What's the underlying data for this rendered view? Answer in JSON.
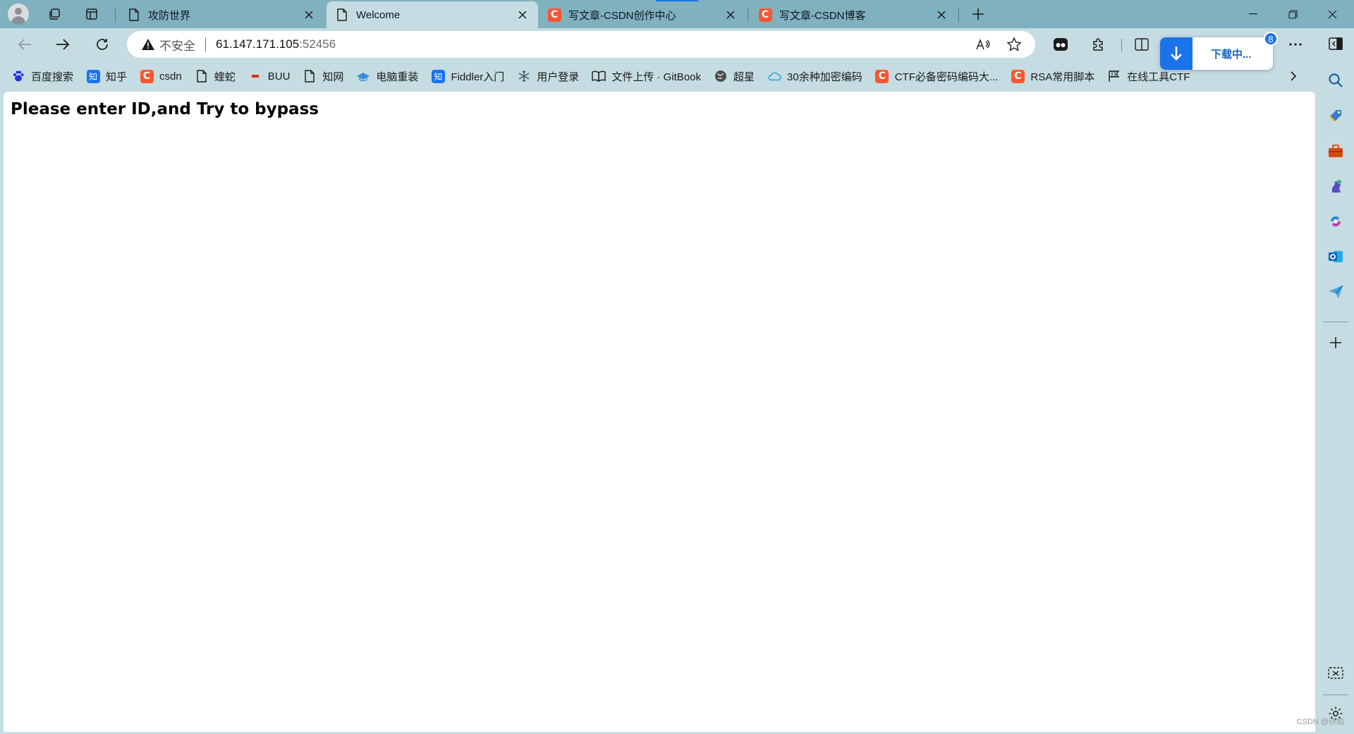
{
  "tabs": [
    {
      "title": "攻防世界",
      "icon": "page-icon",
      "active": false
    },
    {
      "title": "Welcome",
      "icon": "page-icon",
      "active": true
    },
    {
      "title": "写文章-CSDN创作中心",
      "icon": "csdn-icon",
      "active": false
    },
    {
      "title": "写文章-CSDN博客",
      "icon": "csdn-icon",
      "active": false
    }
  ],
  "address": {
    "security_label": "不安全",
    "host": "61.147.171.105",
    "port": ":52456"
  },
  "download": {
    "label": "下载中...",
    "badge_count": "8"
  },
  "favorites": [
    {
      "label": "百度搜索",
      "icon": "baidu-icon"
    },
    {
      "label": "知乎",
      "icon": "zhihu-icon"
    },
    {
      "label": "csdn",
      "icon": "csdn-icon"
    },
    {
      "label": "蝰蛇",
      "icon": "page-icon"
    },
    {
      "label": "BUU",
      "icon": "buu-icon"
    },
    {
      "label": "知网",
      "icon": "page-icon"
    },
    {
      "label": "电脑重装",
      "icon": "hat-icon"
    },
    {
      "label": "Fiddler入门",
      "icon": "zhihu-icon"
    },
    {
      "label": "用户登录",
      "icon": "snowflake-icon"
    },
    {
      "label": "文件上传 · GitBook",
      "icon": "book-icon"
    },
    {
      "label": "超星",
      "icon": "globe-icon"
    },
    {
      "label": "30余种加密编码",
      "icon": "cloud-icon"
    },
    {
      "label": "CTF必备密码编码大...",
      "icon": "csdn-icon"
    },
    {
      "label": "RSA常用脚本",
      "icon": "csdn-icon"
    },
    {
      "label": "在线工具CTF",
      "icon": "flag-icon"
    }
  ],
  "page": {
    "heading": "Please enter ID,and Try to bypass"
  },
  "zhihu_glyph": "知",
  "csdn_glyph": "C",
  "watermark": "CSDN @许如"
}
